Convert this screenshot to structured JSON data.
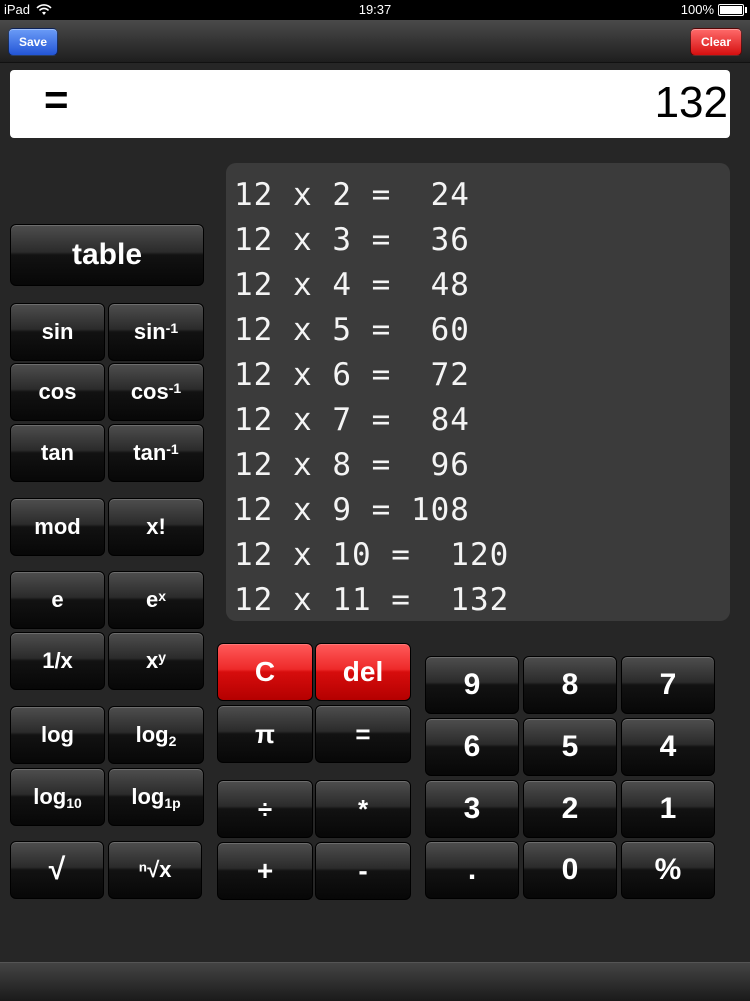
{
  "status_bar": {
    "device": "iPad",
    "time": "19:37",
    "battery": "100%",
    "battery_level": 1.0
  },
  "toolbar": {
    "save_label": "Save",
    "clear_label": "Clear"
  },
  "display": {
    "equals": "=",
    "value": "132"
  },
  "table_rows": [
    "12 x 2 =  24",
    "12 x 3 =  36",
    "12 x 4 =  48",
    "12 x 5 =  60",
    "12 x 6 =  72",
    "12 x 7 =  84",
    "12 x 8 =  96",
    "12 x 9 = 108",
    "12 x 10 =  120",
    "12 x 11 =  132"
  ],
  "keys": {
    "table": "table",
    "sin": "sin",
    "asin": "sin",
    "asin_sup": "-1",
    "cos": "cos",
    "acos": "cos",
    "acos_sup": "-1",
    "tan": "tan",
    "atan": "tan",
    "atan_sup": "-1",
    "mod": "mod",
    "fact": "x!",
    "e": "e",
    "exp": "e",
    "exp_sup": "x",
    "recip": "1/x",
    "pow": "x",
    "pow_sup": "y",
    "log": "log",
    "log2": "log",
    "log2_sub": "2",
    "log10": "log",
    "log10_sub": "10",
    "log1p": "log",
    "log1p_sub": "1p",
    "sqrt": "√",
    "nroot": "ⁿ√x",
    "c": "C",
    "del": "del",
    "pi": "π",
    "equals": "=",
    "div": "÷",
    "mul": "*",
    "plus": "+",
    "minus": "-",
    "n9": "9",
    "n8": "8",
    "n7": "7",
    "n6": "6",
    "n5": "5",
    "n4": "4",
    "n3": "3",
    "n2": "2",
    "n1": "1",
    "dot": ".",
    "n0": "0",
    "pct": "%"
  },
  "colors": {
    "red_key": "#e31b1b",
    "save_blue": "#2f62e0",
    "clear_red": "#e01515"
  }
}
